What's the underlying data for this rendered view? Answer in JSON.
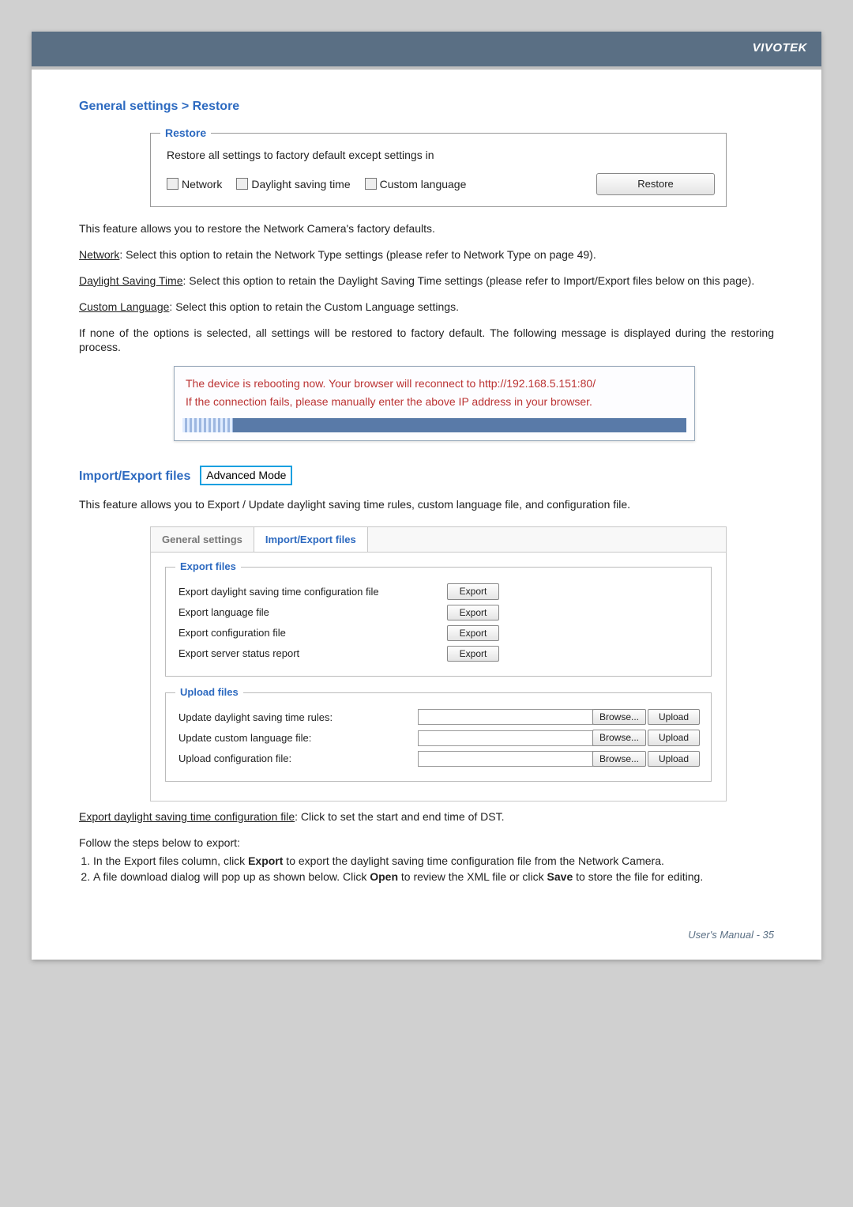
{
  "brand": "VIVOTEK",
  "breadcrumb": "General settings > Restore",
  "restore": {
    "legend": "Restore",
    "desc": "Restore all settings to factory default except settings in",
    "opt_network": "Network",
    "opt_dst": "Daylight saving time",
    "opt_lang": "Custom language",
    "button": "Restore"
  },
  "body": {
    "intro": "This feature allows you to restore the Network Camera's factory defaults.",
    "net_u": "Network",
    "net_txt": ": Select this option to retain the Network Type settings (please refer to Network Type on page 49).",
    "dst_u": "Daylight Saving Time",
    "dst_txt": ": Select this option to retain the Daylight Saving Time settings (please refer to Import/Export files below on this page).",
    "lang_u": "Custom Language",
    "lang_txt": ": Select this option to retain the Custom Language settings.",
    "none_txt": "If none of the options is selected, all settings will be restored to factory default.  The following message is displayed during the restoring process."
  },
  "reboot": {
    "line1": "The device is rebooting now. Your browser will reconnect to http://192.168.5.151:80/",
    "line2": "If the connection fails, please manually enter the above IP address in your browser."
  },
  "impexp": {
    "title": "Import/Export files",
    "badge": "Advanced Mode",
    "desc": "This feature allows you to Export / Update daylight saving time rules, custom language file, and configuration file."
  },
  "tabs": {
    "general": "General settings",
    "impexp": "Import/Export files"
  },
  "export": {
    "legend": "Export files",
    "rows": [
      "Export daylight saving time configuration file",
      "Export language file",
      "Export configuration file",
      "Export server status report"
    ],
    "button": "Export"
  },
  "upload": {
    "legend": "Upload files",
    "rows": [
      "Update daylight saving time rules:",
      "Update custom language file:",
      "Upload configuration file:"
    ],
    "browse": "Browse...",
    "upload": "Upload"
  },
  "after": {
    "exp_u": "Export daylight saving time configuration file",
    "exp_txt": ": Click to set the start and end time of DST.",
    "steps_intro": "Follow the steps below to export:",
    "step1a": "In the Export files column, click ",
    "step1b": "Export",
    "step1c": " to export the daylight saving time configuration file from the Network Camera.",
    "step2a": "A file download dialog will pop up as shown below. Click ",
    "step2b": "Open",
    "step2c": " to review the XML file or click ",
    "step2d": "Save",
    "step2e": " to store the file for editing."
  },
  "footer": {
    "label": "User's Manual - ",
    "page": "35"
  }
}
